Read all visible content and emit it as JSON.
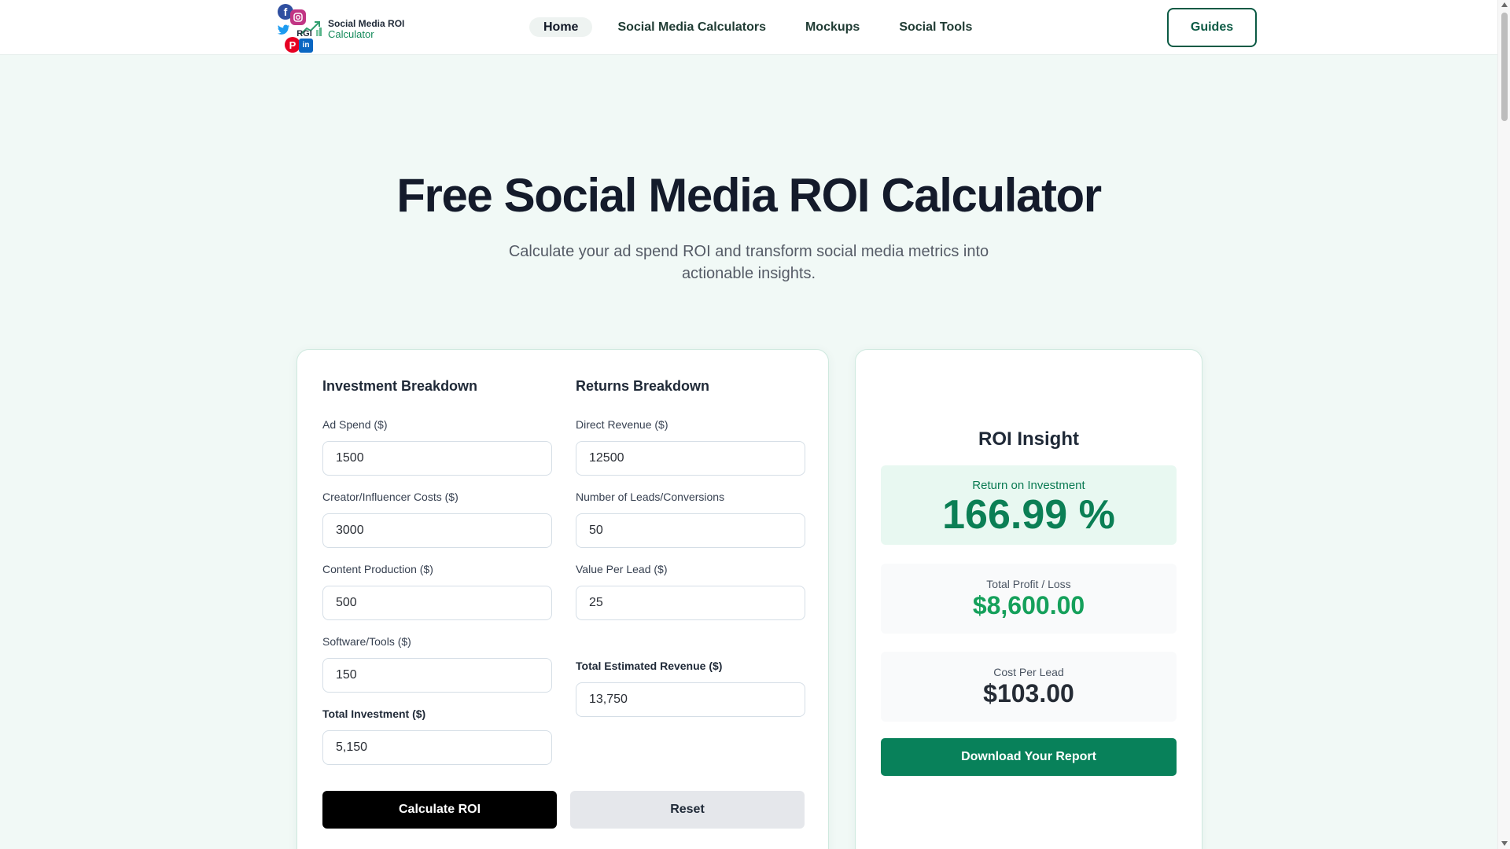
{
  "brand": {
    "line1": "Social Media ROI",
    "line2": "Calculator",
    "mark_text": "RGI",
    "icons": [
      "facebook-icon",
      "instagram-icon",
      "twitter-icon",
      "pinterest-icon",
      "linkedin-icon",
      "trend-arrow-icon"
    ]
  },
  "nav": {
    "items": [
      {
        "label": "Home",
        "active": true
      },
      {
        "label": "Social Media Calculators",
        "active": false
      },
      {
        "label": "Mockups",
        "active": false
      },
      {
        "label": "Social Tools",
        "active": false
      }
    ],
    "guides_label": "Guides"
  },
  "hero": {
    "title": "Free Social Media ROI Calculator",
    "subtitle": "Calculate your ad spend ROI and transform social media metrics into actionable insights."
  },
  "investment": {
    "title": "Investment Breakdown",
    "fields": [
      {
        "label": "Ad Spend ($)",
        "value": "1500"
      },
      {
        "label": "Creator/Influencer Costs ($)",
        "value": "3000"
      },
      {
        "label": "Content Production ($)",
        "value": "500"
      },
      {
        "label": "Software/Tools ($)",
        "value": "150"
      }
    ],
    "total_label": "Total Investment ($)",
    "total_value": "5,150"
  },
  "returns": {
    "title": "Returns Breakdown",
    "fields": [
      {
        "label": "Direct Revenue ($)",
        "value": "12500"
      },
      {
        "label": "Number of Leads/Conversions",
        "value": "50"
      },
      {
        "label": "Value Per Lead ($)",
        "value": "25"
      }
    ],
    "total_label": "Total Estimated Revenue ($)",
    "total_value": "13,750"
  },
  "actions": {
    "calculate_label": "Calculate ROI",
    "reset_label": "Reset"
  },
  "roi": {
    "title": "ROI Insight",
    "return_label": "Return on Investment",
    "return_value": "166.99 %",
    "profit_label": "Total Profit / Loss",
    "profit_value": "$8,600.00",
    "cpl_label": "Cost Per Lead",
    "cpl_value": "$103.00",
    "download_label": "Download Your Report"
  },
  "colors": {
    "page_bg": "#f1f9f6",
    "accent_green": "#08815a",
    "roi_green": "#0b7f55",
    "profit_green": "#15a05b",
    "brand_dark": "#141b2b"
  }
}
